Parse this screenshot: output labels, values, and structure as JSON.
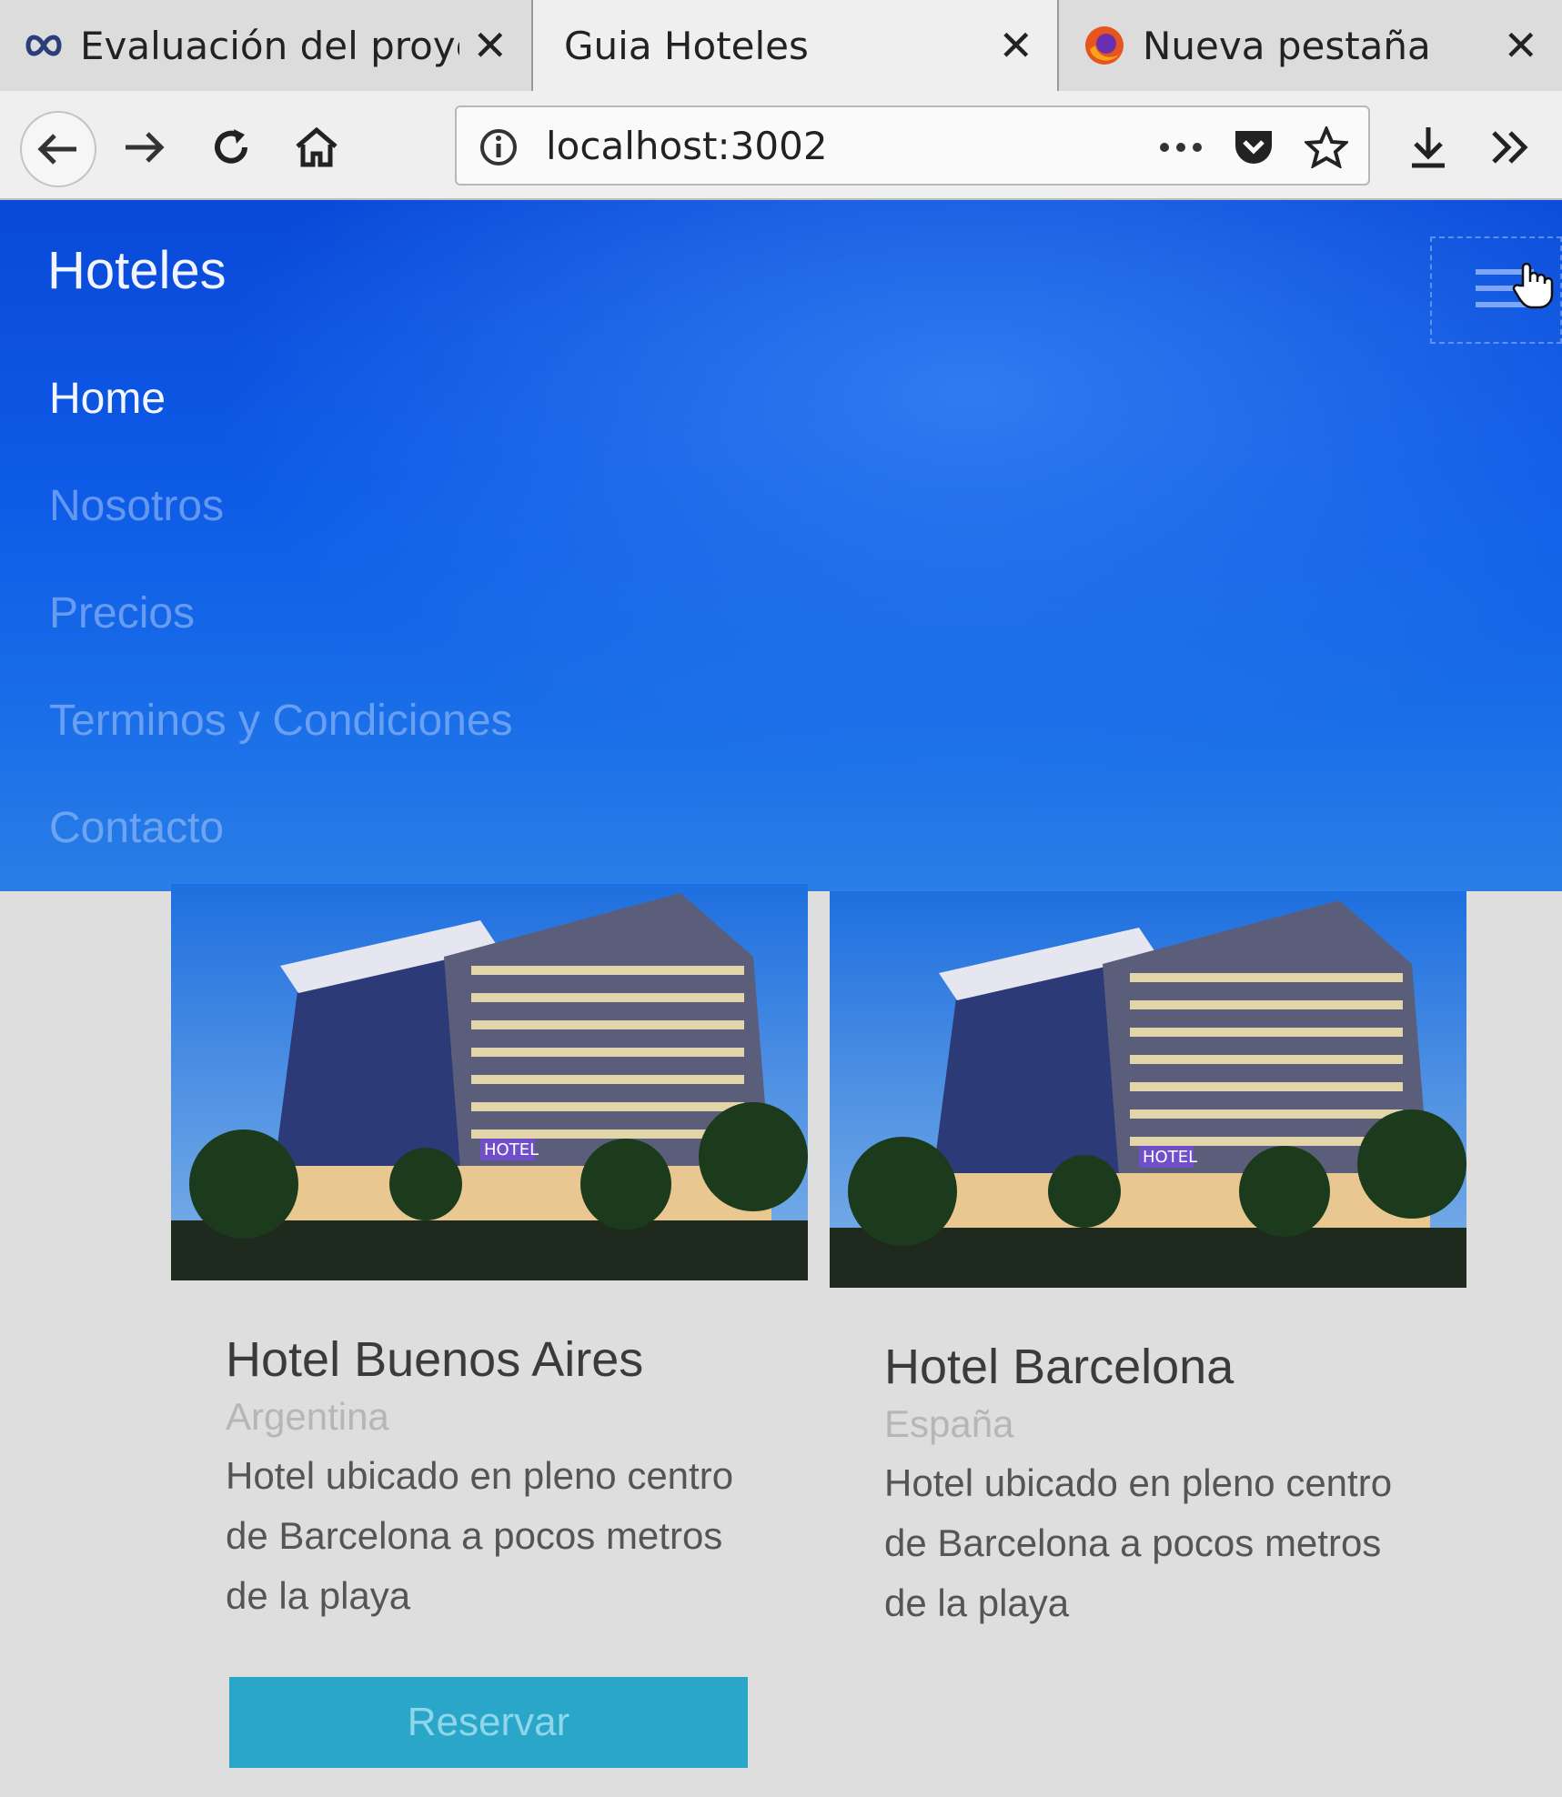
{
  "browser": {
    "tabs": [
      {
        "title": "Evaluación del proye",
        "favicon": "infinity-icon"
      },
      {
        "title": "Guia Hoteles",
        "favicon": "none"
      },
      {
        "title": "Nueva pestaña",
        "favicon": "firefox-icon"
      }
    ],
    "active_tab": 1,
    "url": "localhost:3002"
  },
  "navbar": {
    "brand": "Hoteles",
    "menu": [
      "Home",
      "Nosotros",
      "Precios",
      "Terminos y Condiciones",
      "Contacto"
    ],
    "active_item": "Home"
  },
  "cards": [
    {
      "title": "Hotel Buenos Aires",
      "subtitle": "Argentina",
      "text": "Hotel ubicado en pleno centro de Barcelona a pocos metros de la playa",
      "button": "Reservar",
      "image_sign": "HOTEL"
    },
    {
      "title": "Hotel Barcelona",
      "subtitle": "España",
      "text": "Hotel ubicado en pleno centro de Barcelona a pocos metros de la playa",
      "image_sign": "HOTEL"
    }
  ],
  "colors": {
    "hero": "#0d5ae6",
    "button": "#2aa6c8",
    "tabstrip": "#3d6fd6"
  }
}
